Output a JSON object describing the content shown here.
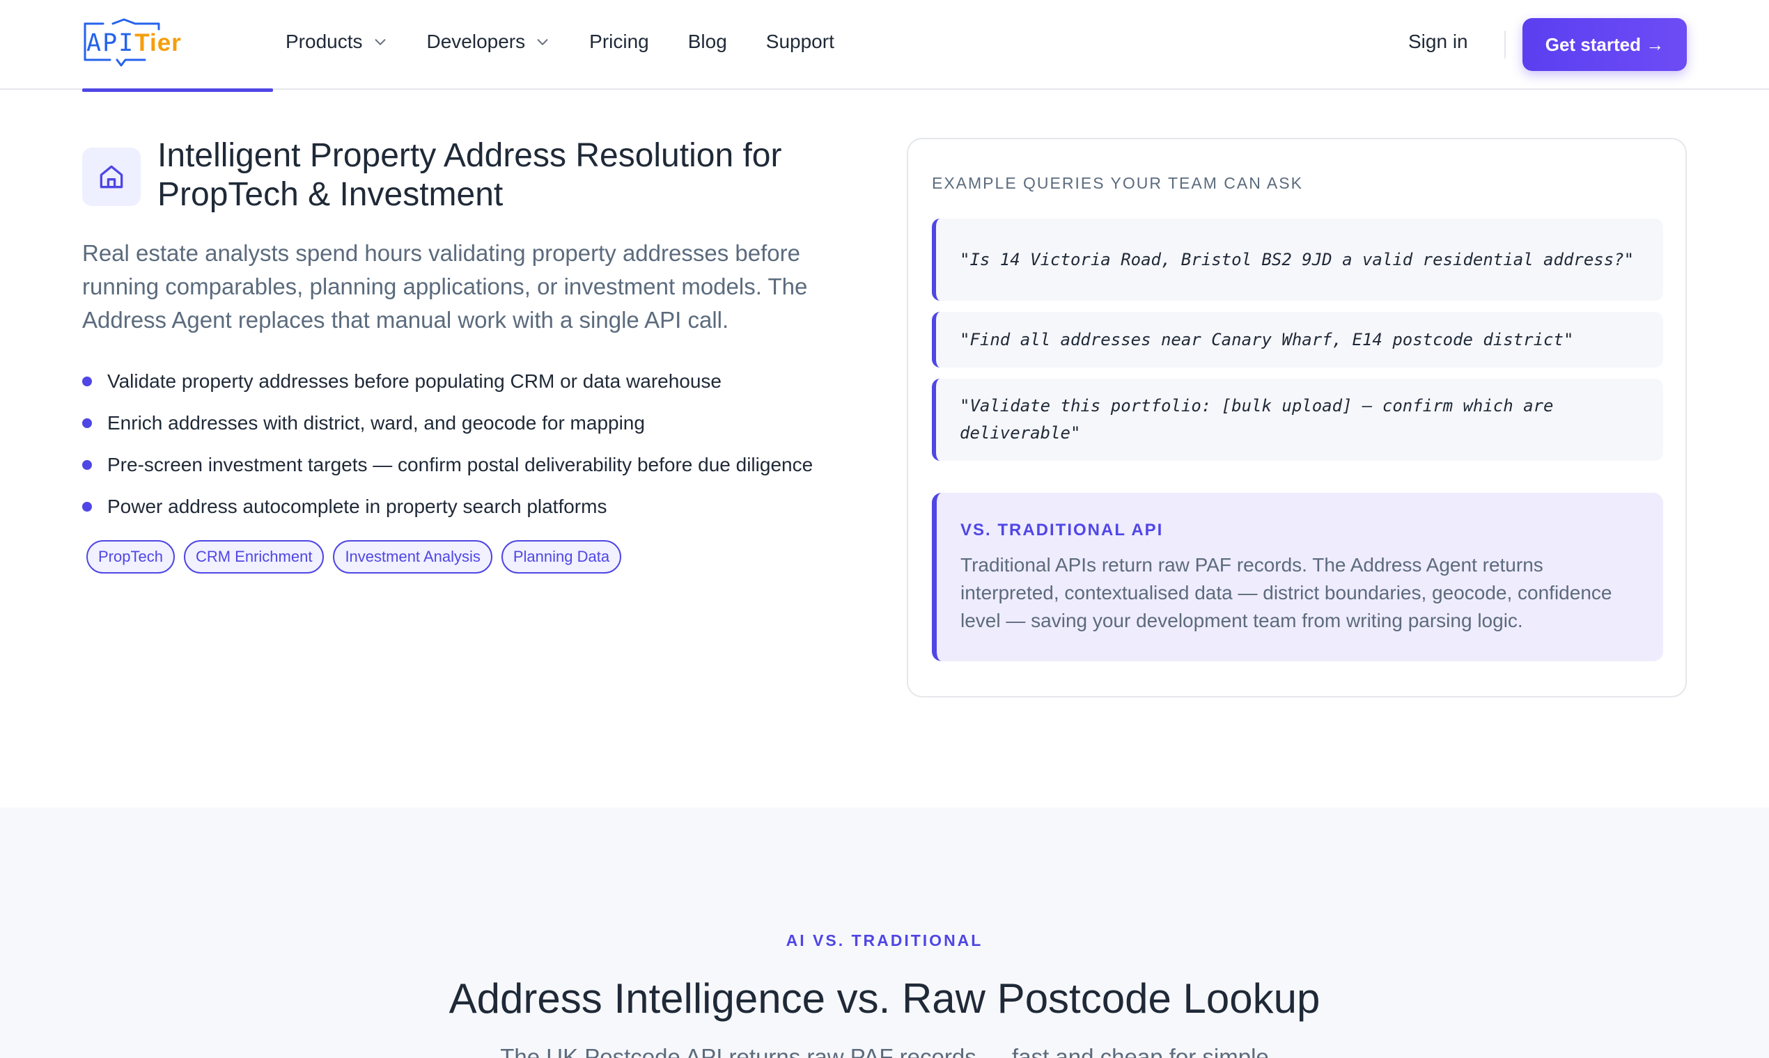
{
  "header": {
    "logo": {
      "api": "API",
      "tier": "Tier"
    },
    "nav": [
      {
        "label": "Products",
        "has_dropdown": true
      },
      {
        "label": "Developers",
        "has_dropdown": true
      },
      {
        "label": "Pricing",
        "has_dropdown": false
      },
      {
        "label": "Blog",
        "has_dropdown": false
      },
      {
        "label": "Support",
        "has_dropdown": false
      }
    ],
    "sign_in": "Sign in",
    "cta": "Get started →"
  },
  "main": {
    "icon": "home-icon",
    "title": "Intelligent Property Address Resolution for PropTech & Investment",
    "lead": "Real estate analysts spend hours validating property addresses before running comparables, planning applications, or investment models. The Address Agent replaces that manual work with a single API call.",
    "bullets": [
      "Validate property addresses before populating CRM or data warehouse",
      "Enrich addresses with district, ward, and geocode for mapping",
      "Pre-screen investment targets — confirm postal deliverability before due diligence",
      "Power address autocomplete in property search platforms"
    ],
    "tags": [
      "PropTech",
      "CRM Enrichment",
      "Investment Analysis",
      "Planning Data"
    ]
  },
  "card": {
    "label": "EXAMPLE QUERIES YOUR TEAM CAN ASK",
    "queries": [
      "\"Is 14 Victoria Road, Bristol BS2 9JD a valid residential address?\"",
      "\"Find all addresses near Canary Wharf, E14 postcode district\"",
      "\"Validate this portfolio: [bulk upload] — confirm which are deliverable\""
    ],
    "vs": {
      "title": "VS. TRADITIONAL API",
      "body": "Traditional APIs return raw PAF records. The Address Agent returns interpreted, contextualised data — district boundaries, geocode, confidence level — saving your development team from writing parsing logic."
    }
  },
  "section2": {
    "kicker": "AI VS. TRADITIONAL",
    "heading": "Address Intelligence vs. Raw Postcode Lookup",
    "sub": "The UK Postcode API returns raw PAF records — fast and cheap for simple"
  },
  "colors": {
    "accent": "#4f46e5",
    "brand_blue": "#2563eb",
    "brand_orange": "#f59e0b"
  }
}
